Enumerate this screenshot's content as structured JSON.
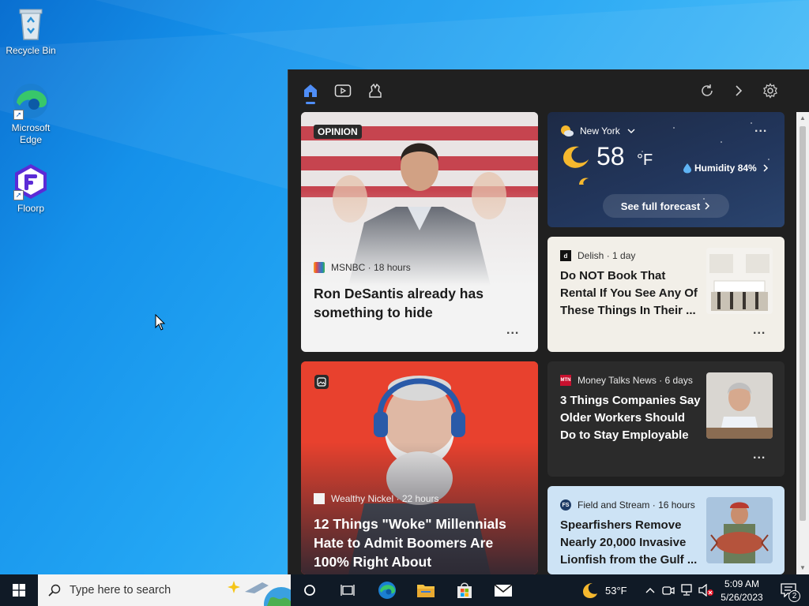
{
  "desktop": {
    "icons": [
      {
        "label": "Recycle Bin"
      },
      {
        "label": "Microsoft Edge"
      },
      {
        "label": "Floorp"
      }
    ]
  },
  "panel": {
    "tabs": [
      "home-icon",
      "video-icon",
      "gaming-icon"
    ],
    "actions": [
      "refresh-icon",
      "chevron-right-icon",
      "gear-icon"
    ]
  },
  "feed": {
    "hero": {
      "badge": "OPINION",
      "source": "MSNBC",
      "age": "18 hours",
      "title": "Ron DeSantis already has something to hide",
      "more": "..."
    },
    "weather": {
      "location": "New York",
      "temp": "58",
      "unit": "°F",
      "humidity_label": "Humidity",
      "humidity_value": "84%",
      "forecast_link": "See full forecast",
      "more": "..."
    },
    "delish": {
      "source": "Delish",
      "age": "1 day",
      "title": "Do NOT Book That Rental If You See Any Of These Things In Their ...",
      "more": "..."
    },
    "boomer": {
      "source": "Wealthy Nickel",
      "age": "22 hours",
      "title": "12 Things \"Woke\" Millennials Hate to Admit Boomers Are 100% Right About"
    },
    "mtn": {
      "logo": "MTN",
      "source": "Money Talks News",
      "age": "6 days",
      "title": "3 Things Companies Say Older Workers Should Do to Stay Employable",
      "more": "..."
    },
    "fs": {
      "logo": "FS",
      "source": "Field and Stream",
      "age": "16 hours",
      "title": "Spearfishers Remove Nearly 20,000 Invasive Lionfish from the Gulf ..."
    }
  },
  "taskbar": {
    "search_placeholder": "Type here to search",
    "weather_temp": "53°F",
    "time": "5:09 AM",
    "date": "5/26/2023",
    "notification_count": "2"
  },
  "colors": {
    "accent": "#4f8ef7",
    "panel_bg": "#202020",
    "taskbar_bg": "#101a26",
    "hero_card_bg": "#f3f3f3",
    "boomer_card_bg": "#e8412e",
    "delish_card_bg": "#f2efe8",
    "mtn_card_bg": "#2b2b2b",
    "fs_card_bg": "#cde3f5"
  }
}
